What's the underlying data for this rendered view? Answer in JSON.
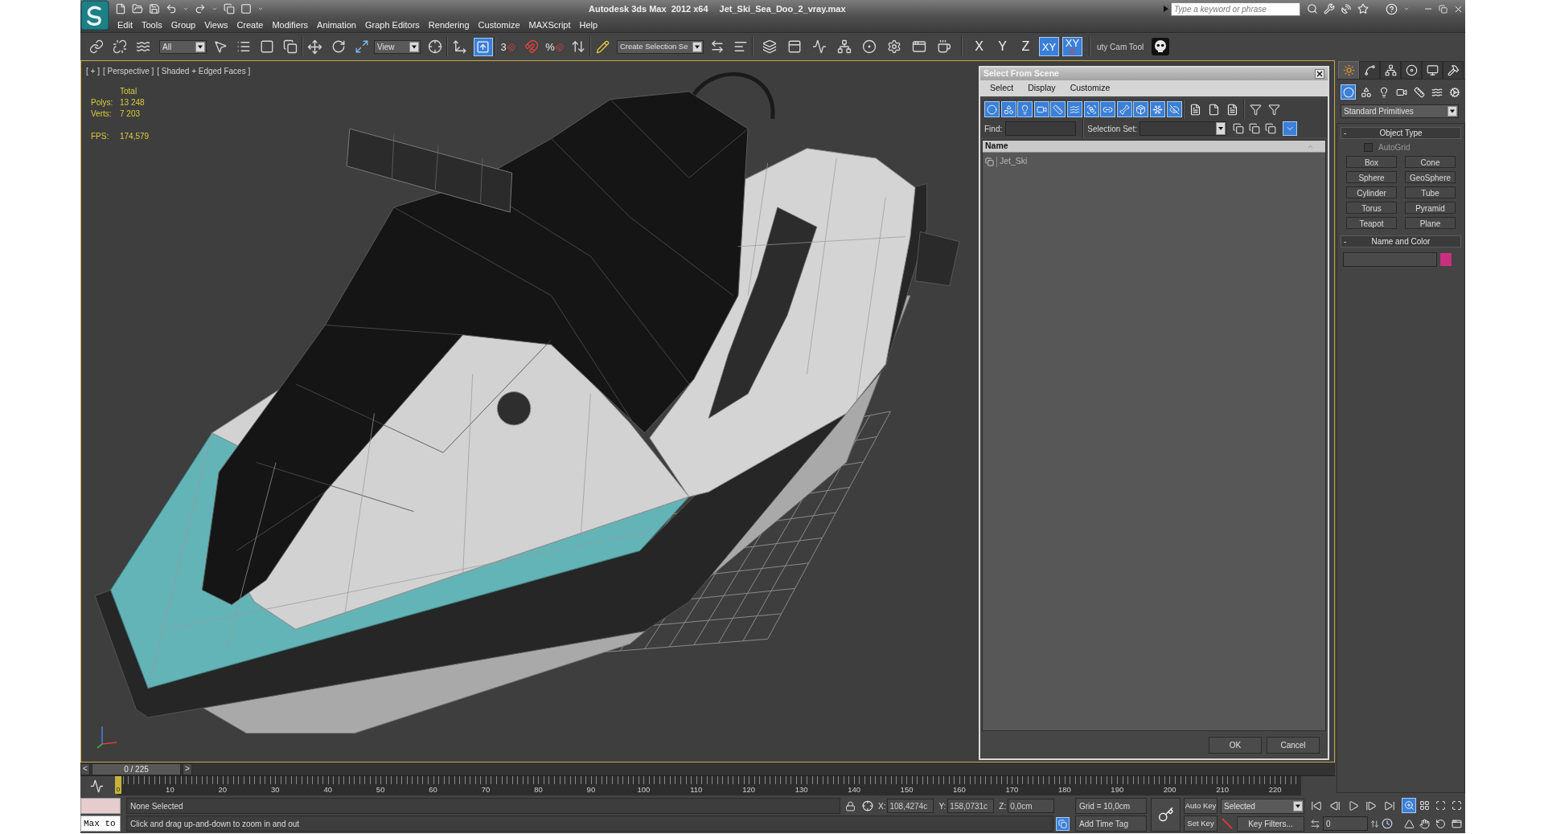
{
  "title_bar": {
    "title": "Autodesk 3ds Max  2012 x64",
    "document": "Jet_Ski_Sea_Doo_2_vray.max",
    "search": {
      "placeholder": "Type a keyword or phrase"
    }
  },
  "menu_bar": [
    "Edit",
    "Tools",
    "Group",
    "Views",
    "Create",
    "Modifiers",
    "Animation",
    "Graph Editors",
    "Rendering",
    "Customize",
    "MAXScript",
    "Help"
  ],
  "main_toolbar": {
    "selection_filter": "All",
    "reference_coordinate_system": "View",
    "keyboard_shortcut_override": {
      "selected": true
    },
    "snaps": [
      {
        "kind": "snap",
        "label": "3"
      },
      {
        "kind": "angle"
      },
      {
        "kind": "percent",
        "label": "%"
      },
      {
        "kind": "spinner"
      }
    ],
    "named_selection_set": "Create Selection Se",
    "axis_constraints": [
      {
        "kind": "axis",
        "label": "X",
        "selected": false
      },
      {
        "kind": "axis",
        "label": "Y",
        "selected": false
      },
      {
        "kind": "axis",
        "label": "Z",
        "selected": false
      },
      {
        "kind": "axis",
        "label": "XY",
        "selected": true
      },
      {
        "kind": "axis_snap",
        "label": "XY",
        "selected": true
      }
    ],
    "toolbar_label": "uty Cam Tool"
  },
  "viewport": {
    "active": true,
    "labels": [
      "[ + ]",
      "[ Perspective ]",
      "[ Shaded + Edged Faces ]"
    ],
    "statistics": {
      "heading": "Total",
      "rows": [
        {
          "label": "Polys:",
          "value": "13 248"
        },
        {
          "label": "Verts:",
          "value": "7 203"
        }
      ],
      "fps": {
        "label": "FPS:",
        "value": "174,579"
      }
    }
  },
  "select_from_scene": {
    "title": "Select From Scene",
    "menu": [
      "Select",
      "Display",
      "Customize"
    ],
    "display_filters": [
      {
        "kind": "geometry",
        "selected": true
      },
      {
        "kind": "shapes",
        "selected": true
      },
      {
        "kind": "lights",
        "selected": true
      },
      {
        "kind": "cameras",
        "selected": true
      },
      {
        "kind": "helpers",
        "selected": true
      },
      {
        "kind": "space_warps",
        "selected": true
      },
      {
        "kind": "groups",
        "selected": true
      },
      {
        "kind": "xrefs",
        "selected": true
      },
      {
        "kind": "bones",
        "selected": true
      },
      {
        "kind": "containers",
        "selected": true
      },
      {
        "kind": "frozen",
        "selected": true
      },
      {
        "kind": "hidden",
        "selected": true
      }
    ],
    "find": {
      "label": "Find:"
    },
    "selection_set": {
      "label": "Selection Set:"
    },
    "columns": [
      "Name"
    ],
    "objects": [
      {
        "name": "Jet_Ski"
      }
    ],
    "buttons": [
      "OK",
      "Cancel"
    ]
  },
  "command_panel": {
    "tabs": [
      {
        "kind": "create",
        "selected": true
      },
      {
        "kind": "modify",
        "selected": false
      },
      {
        "kind": "hierarchy",
        "selected": false
      },
      {
        "kind": "motion",
        "selected": false
      },
      {
        "kind": "display",
        "selected": false
      },
      {
        "kind": "utilities",
        "selected": false
      }
    ],
    "categories": [
      {
        "kind": "geometry",
        "selected": true
      },
      {
        "kind": "shapes",
        "selected": false
      },
      {
        "kind": "lights",
        "selected": false
      },
      {
        "kind": "cameras",
        "selected": false
      },
      {
        "kind": "helpers",
        "selected": false
      },
      {
        "kind": "space_warps",
        "selected": false
      },
      {
        "kind": "systems",
        "selected": false
      }
    ],
    "primitive_type": "Standard Primitives",
    "rollouts": [
      {
        "kind": "object_type",
        "toggle": "-",
        "title": "Object Type",
        "autogrid": {
          "label": "AutoGrid",
          "checked": false
        },
        "buttons": [
          "Box",
          "Cone",
          "Sphere",
          "GeoSphere",
          "Cylinder",
          "Tube",
          "Torus",
          "Pyramid",
          "Teapot",
          "Plane"
        ]
      },
      {
        "kind": "name_and_color",
        "toggle": "-",
        "title": "Name and Color",
        "color": "#c8307f"
      }
    ]
  },
  "time_slider": {
    "previous": "<",
    "position": "0 / 225",
    "next": ">"
  },
  "track_bar": {
    "current": "0",
    "frame_labels": [
      "10",
      "20",
      "30",
      "40",
      "50",
      "60",
      "70",
      "80",
      "90",
      "100",
      "110",
      "120",
      "130",
      "140",
      "150",
      "160",
      "170",
      "180",
      "190",
      "200",
      "210",
      "220"
    ]
  },
  "status_bar": {
    "listener": "Max to",
    "selection": "None Selected",
    "prompt": "Click and drag up-and-down to zoom in and out",
    "coordinates": [
      {
        "label": "X:",
        "value": "108,4274c"
      },
      {
        "label": "Y:",
        "value": "158,0731c"
      },
      {
        "label": "Z:",
        "value": "0,0cm"
      }
    ],
    "grid": "Grid = 10,0cm",
    "add_time_tag": "Add Time Tag"
  },
  "animation_controls": {
    "auto_key": "Auto Key",
    "set_key": "Set Key",
    "key_mode": "Selected",
    "key_filters": "Key Filters...",
    "current_frame": "0"
  },
  "viewport_navigation": [
    {
      "kind": "zoom",
      "selected": true
    },
    {
      "kind": "zoom_all",
      "selected": false
    },
    {
      "kind": "zoom_extents",
      "selected": false
    },
    {
      "kind": "zoom_extents_all",
      "selected": false
    },
    {
      "kind": "field_of_view",
      "selected": false
    },
    {
      "kind": "pan",
      "selected": false
    },
    {
      "kind": "orbit",
      "selected": false
    },
    {
      "kind": "maximize",
      "selected": false
    }
  ]
}
